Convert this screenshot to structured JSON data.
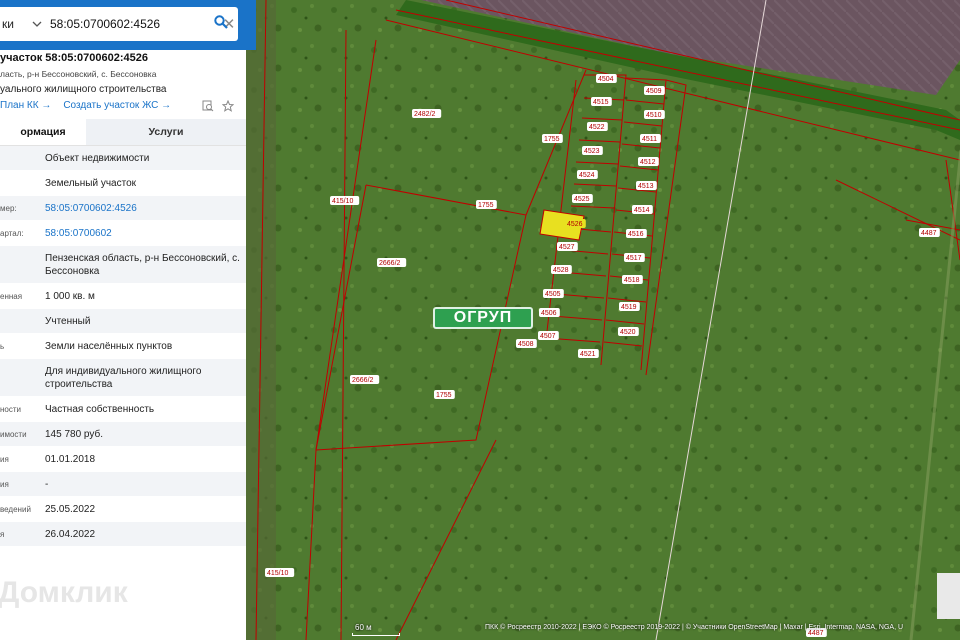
{
  "search": {
    "type_label": "ки",
    "value": "58:05:0700602:4526"
  },
  "card": {
    "title": "участок 58:05:0700602:4526",
    "address": "ласть, р-н Бессоновский, с. Бессоновка",
    "purpose": "уального жилищного строительства",
    "link_plan": "План КК →",
    "link_create": "Создать участок ЖС →"
  },
  "tabs": {
    "info": "ормация",
    "services": "Услуги"
  },
  "rows": [
    {
      "label": "",
      "value": "Объект недвижимости"
    },
    {
      "label": "",
      "value": "Земельный участок"
    },
    {
      "label": "мер:",
      "value": "58:05:0700602:4526"
    },
    {
      "label": "артал:",
      "value": "58:05:0700602"
    },
    {
      "label": "",
      "value": "Пензенская область, р-н Бессоновский, с. Бессоновка"
    },
    {
      "label": "енная",
      "value": "1 000 кв. м"
    },
    {
      "label": "",
      "value": "Учтенный"
    },
    {
      "label": "ь",
      "value": "Земли населённых пунктов"
    },
    {
      "label": "",
      "value": "Для индивидуального жилищного строительства"
    },
    {
      "label": "ности",
      "value": "Частная собственность"
    },
    {
      "label": "имости",
      "value": "145 780 руб."
    },
    {
      "label": "ия",
      "value": "01.01.2018"
    },
    {
      "label": "ия",
      "value": "-"
    },
    {
      "label": "ведений",
      "value": "25.05.2022"
    },
    {
      "label": "я",
      "value": "26.04.2022"
    }
  ],
  "watermark": "Домклик",
  "map": {
    "badge": "ОГРУП",
    "scale": "60 м",
    "attribution": "ПКК © Росреестр 2010-2022 | ЕЭКО © Росреестр 2019-2022 | © Участники OpenStreetMap | Maxar | Esri, Intermap, NASA, NGA, U",
    "plot_labels": [
      "4504",
      "4509",
      "4515",
      "4510",
      "4522",
      "4511",
      "4523",
      "4512",
      "4524",
      "4513",
      "4525",
      "4514",
      "4526",
      "4516",
      "4527",
      "4517",
      "4528",
      "4518",
      "4505",
      "4519",
      "4506",
      "4520",
      "4507",
      "4521",
      "4508",
      "4487",
      "1755",
      "1755",
      "1755",
      "2482/2",
      "2666/2",
      "2666/2",
      "415/10",
      "415/10",
      "4487"
    ],
    "selected_plot": "4526",
    "colors": {
      "boundary": "#c00000",
      "selected_fill": "#e8e020",
      "panel_accent": "#1a73c8",
      "badge": "#2ea050"
    }
  }
}
